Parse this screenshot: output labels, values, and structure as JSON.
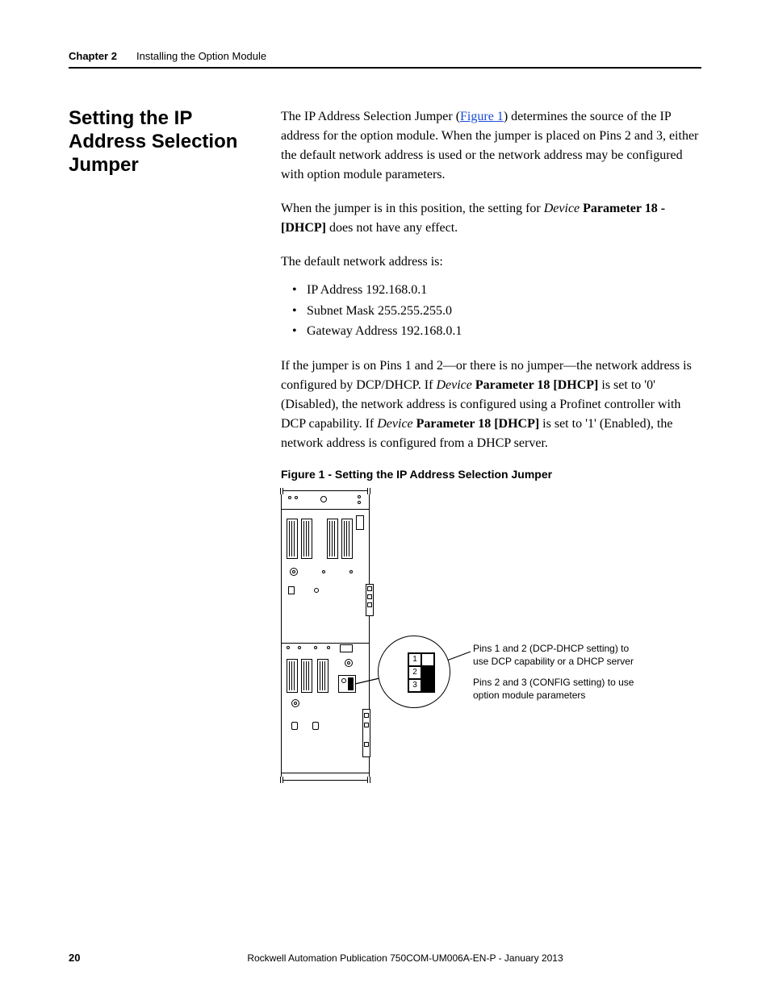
{
  "header": {
    "chapter": "Chapter 2",
    "title": "Installing the Option Module"
  },
  "section_heading": "Setting the IP Address Selection Jumper",
  "para1": {
    "pre": "The IP Address Selection Jumper (",
    "link": "Figure 1",
    "post": ") determines the source of the IP address for the option module. When the jumper is placed on Pins 2 and 3, either the default network address is used or the network address may be configured with option module parameters."
  },
  "para2": {
    "pre": "When the jumper is in this position, the setting for ",
    "italic1": "Device",
    "mid": " ",
    "bold1": "Parameter 18 - [DHCP]",
    "post": " does not have any effect."
  },
  "para3": "The default network address is:",
  "bullets": [
    "IP Address 192.168.0.1",
    "Subnet Mask 255.255.255.0",
    "Gateway Address 192.168.0.1"
  ],
  "para4": {
    "a": "If the jumper is on Pins 1 and 2—or there is no jumper—the network address is configured by DCP/DHCP. If ",
    "b_italic": "Device",
    "c": " ",
    "d_bold": "Parameter 18 [DHCP]",
    "e": " is set to '0' (Disabled), the network address is configured using a Profinet controller with DCP capability. If ",
    "f_italic": "Device",
    "g": " ",
    "h_bold": "Parameter 18 [DHCP]",
    "i": " is set to '1' (Enabled), the network address is configured from a DHCP server."
  },
  "figure": {
    "caption": "Figure 1 - Setting the IP Address Selection Jumper",
    "pins": [
      "1",
      "2",
      "3"
    ],
    "callout1": "Pins 1 and 2 (DCP-DHCP setting) to use DCP capability or a DHCP server",
    "callout2": "Pins 2 and 3 (CONFIG setting) to use option module parameters"
  },
  "footer": {
    "page": "20",
    "publication": "Rockwell Automation Publication 750COM-UM006A-EN-P - January 2013"
  }
}
